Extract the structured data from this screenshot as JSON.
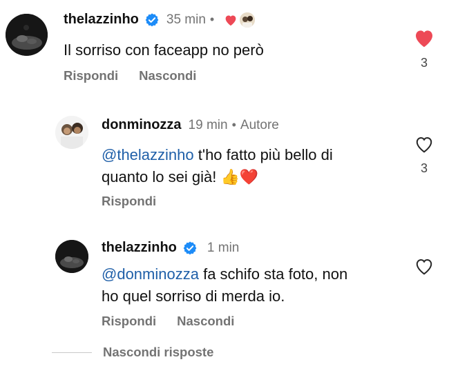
{
  "comments": [
    {
      "username": "thelazzinho",
      "verified": true,
      "time": "35 min",
      "dot": "•",
      "text": "Il sorriso con faceapp no però",
      "actions": {
        "reply": "Rispondi",
        "hide": "Nascondi"
      },
      "likes": "3",
      "liked": true
    },
    {
      "username": "donminozza",
      "time": "19 min",
      "dot": "•",
      "author_label": "Autore",
      "mention": "@thelazzinho",
      "text_line1": " t'ho fatto più bello di",
      "text_line2": "quanto lo sei già! 👍❤️",
      "actions": {
        "reply": "Rispondi"
      },
      "likes": "3",
      "liked": false
    },
    {
      "username": "thelazzinho",
      "verified": true,
      "time": "1 min",
      "mention": "@donminozza",
      "text_line1": " fa schifo sta foto, non",
      "text_line2": "ho quel sorriso di merda io.",
      "actions": {
        "reply": "Rispondi",
        "hide": "Nascondi"
      },
      "liked": false
    }
  ],
  "hide_replies_label": "Nascondi risposte",
  "colors": {
    "like_red": "#ed4956",
    "verified_blue": "#1d8cf8",
    "mention_blue": "#1f5fa8",
    "secondary_text": "#737373"
  }
}
